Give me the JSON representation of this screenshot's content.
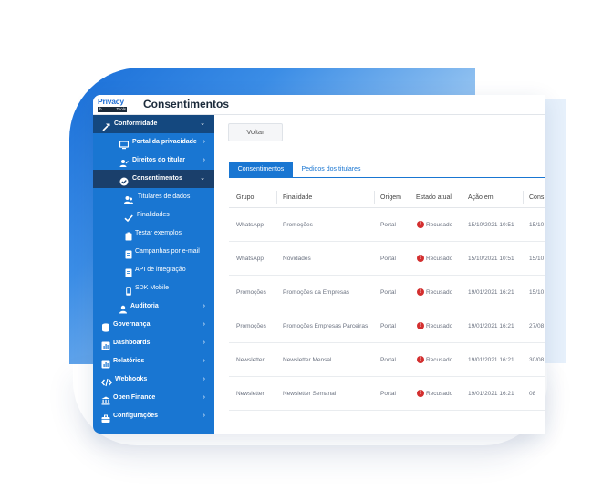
{
  "app": {
    "logo_line1": "Privacy",
    "logo_line2_left": "b",
    "logo_line2_right": "Tools",
    "page_title": "Consentimentos"
  },
  "sidebar": {
    "items": [
      {
        "label": "Conformidade",
        "icon": "hammer-icon",
        "chevron": "⌄"
      },
      {
        "label": "Portal da privacidade",
        "icon": "monitor-icon",
        "chevron": "›"
      },
      {
        "label": "Direitos do titular",
        "icon": "user-edit-icon",
        "chevron": "›"
      },
      {
        "label": "Consentimentos",
        "icon": "check-circle-icon",
        "chevron": "⌄"
      },
      {
        "label": "Titulares de dados",
        "icon": "users-icon"
      },
      {
        "label": "Finalidades",
        "icon": "check-icon"
      },
      {
        "label": "Testar exemplos",
        "icon": "clipboard-icon"
      },
      {
        "label": "Campanhas por e-mail",
        "icon": "document-icon"
      },
      {
        "label": "API de integração",
        "icon": "document-icon"
      },
      {
        "label": "SDK Mobile",
        "icon": "mobile-icon"
      },
      {
        "label": "Auditoria",
        "icon": "auditor-icon",
        "chevron": "›"
      },
      {
        "label": "Governança",
        "icon": "database-icon",
        "chevron": "›"
      },
      {
        "label": "Dashboards",
        "icon": "chart-icon",
        "chevron": "›"
      },
      {
        "label": "Relatórios",
        "icon": "chart-icon",
        "chevron": "›"
      },
      {
        "label": "Webhooks",
        "icon": "code-icon",
        "chevron": "›"
      },
      {
        "label": "Open Finance",
        "icon": "bank-icon",
        "chevron": "›"
      },
      {
        "label": "Configurações",
        "icon": "briefcase-icon",
        "chevron": "›"
      }
    ]
  },
  "content": {
    "back_button": "Voltar",
    "tabs": [
      "Consentimentos",
      "Pedidos dos titulares"
    ],
    "columns": [
      "Grupo",
      "Finalidade",
      "Origem",
      "Estado atual",
      "Ação em",
      "Cons"
    ],
    "rows": [
      {
        "grupo": "WhatsApp",
        "finalidade": "Promoções",
        "origem": "Portal",
        "estado": "Recusado",
        "acao": "15/10/2021 10:51",
        "cons": "15/10"
      },
      {
        "grupo": "WhatsApp",
        "finalidade": "Novidades",
        "origem": "Portal",
        "estado": "Recusado",
        "acao": "15/10/2021 10:51",
        "cons": "15/10"
      },
      {
        "grupo": "Promoções",
        "finalidade": "Promoções da Empresas",
        "origem": "Portal",
        "estado": "Recusado",
        "acao": "19/01/2021 16:21",
        "cons": "15/10"
      },
      {
        "grupo": "Promoções",
        "finalidade": "Promoções Empresas Parceiras",
        "origem": "Portal",
        "estado": "Recusado",
        "acao": "19/01/2021 16:21",
        "cons": "27/08"
      },
      {
        "grupo": "Newsletter",
        "finalidade": "Newsletter Mensal",
        "origem": "Portal",
        "estado": "Recusado",
        "acao": "19/01/2021 16:21",
        "cons": "30/08"
      },
      {
        "grupo": "Newsletter",
        "finalidade": "Newsletter Semanal",
        "origem": "Portal",
        "estado": "Recusado",
        "acao": "19/01/2021 16:21",
        "cons": "08"
      }
    ]
  },
  "colors": {
    "primary": "#1976d2",
    "sidebar_dark": "#14487f",
    "status_refused": "#d32f2f"
  }
}
